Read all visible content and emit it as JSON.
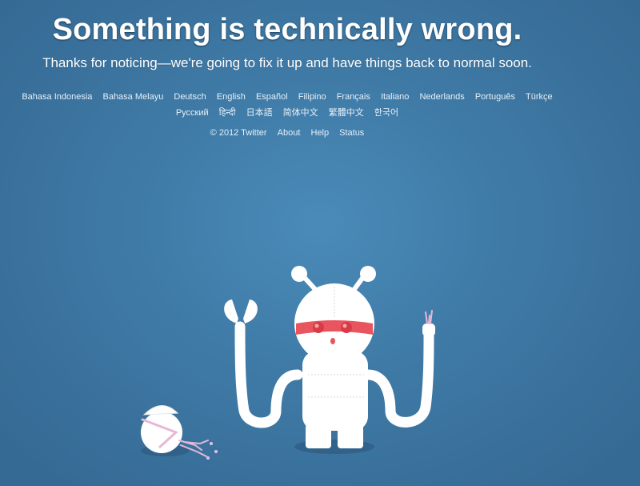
{
  "header": {
    "title": "Something is technically wrong.",
    "subtitle": "Thanks for noticing—we're going to fix it up and have things back to normal soon."
  },
  "languages": {
    "row1": [
      "Bahasa Indonesia",
      "Bahasa Melayu",
      "Deutsch",
      "English",
      "Español",
      "Filipino",
      "Français",
      "Italiano",
      "Nederlands",
      "Português",
      "Türkçe"
    ],
    "row2": [
      "Русский",
      "हिन्दी",
      "日本語",
      "简体中文",
      "繁體中文",
      "한국어"
    ]
  },
  "footer": {
    "copyright": "© 2012 Twitter",
    "about": "About",
    "help": "Help",
    "status": "Status"
  },
  "illustration": {
    "name": "robot-illustration",
    "visor_color": "#e8555f",
    "body_color": "#ffffff"
  }
}
